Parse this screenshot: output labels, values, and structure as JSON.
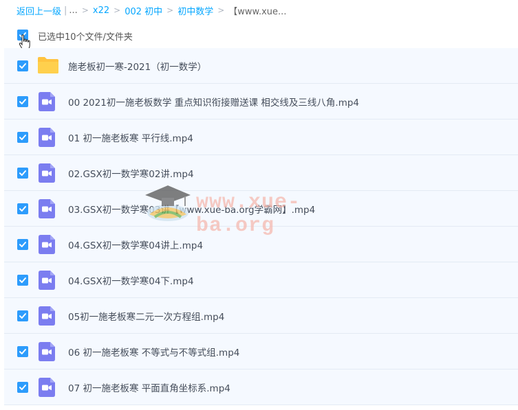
{
  "breadcrumb": {
    "back": "返回上一级",
    "ellipsis": "...",
    "sep": ">",
    "items": [
      "x22",
      "002 初中",
      "初中数学"
    ],
    "current": "【www.xue..."
  },
  "selection": {
    "text": "已选中10个文件/文件夹"
  },
  "files": [
    {
      "name": "施老板初一寒-2021（初一数学）",
      "icon": "folder-icon"
    },
    {
      "name": "00 2021初一施老板数学 重点知识衔接赠送课 相交线及三线八角.mp4",
      "icon": "video-file-icon"
    },
    {
      "name": "01 初一施老板寒 平行线.mp4",
      "icon": "video-file-icon"
    },
    {
      "name": "02.GSX初一数学寒02讲.mp4",
      "icon": "video-file-icon"
    },
    {
      "name": "03.GSX初一数学寒03讲【www.xue-ba.org学霸网】.mp4",
      "icon": "video-file-icon"
    },
    {
      "name": "04.GSX初一数学寒04讲上.mp4",
      "icon": "video-file-icon"
    },
    {
      "name": "04.GSX初一数学寒04下.mp4",
      "icon": "video-file-icon"
    },
    {
      "name": "05初一施老板寒二元一次方程组.mp4",
      "icon": "video-file-icon"
    },
    {
      "name": "06 初一施老板寒 不等式与不等式组.mp4",
      "icon": "video-file-icon"
    },
    {
      "name": "07 初一施老板寒 平面直角坐标系.mp4",
      "icon": "video-file-icon"
    }
  ],
  "watermark": {
    "text": "www.xue-ba.org"
  },
  "colors": {
    "accent": "#06a7ff",
    "checkbox": "#2d9cfc",
    "video": "#7b7df0",
    "folder": "#ffc440"
  }
}
